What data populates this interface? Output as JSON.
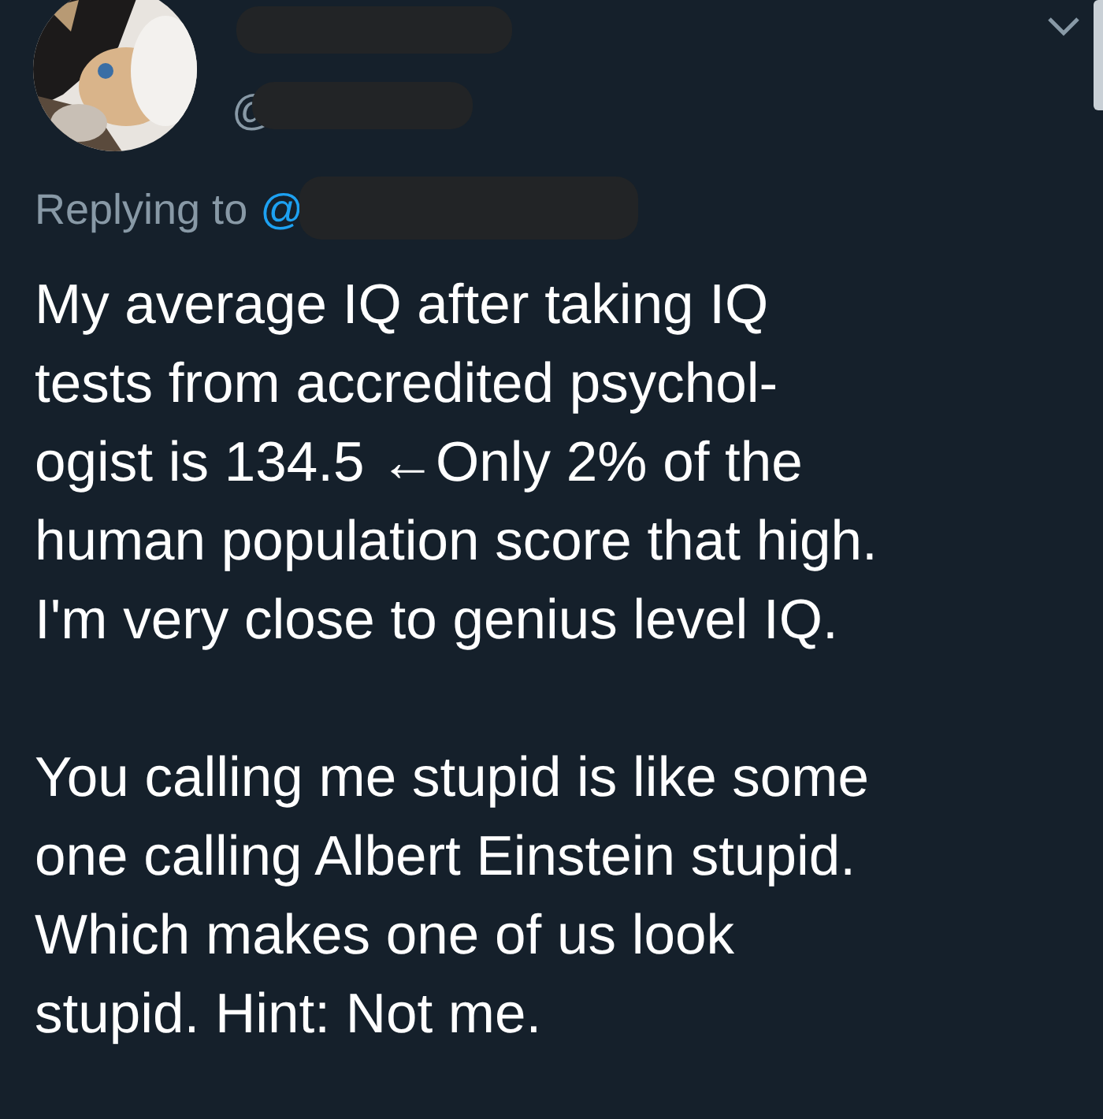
{
  "tweet": {
    "author_handle": "@",
    "replying_label": "Replying to",
    "reply_handle": "@",
    "paragraphs": [
      "My average IQ after taking IQ\ntests from accredited psychol-\nogist is 134.5 ←Only 2% of the\nhuman population score that high.\nI'm very close to genius level IQ.",
      "You calling me stupid is like some\none calling Albert Einstein stupid.\nWhich makes one of us look\nstupid. Hint: Not me."
    ]
  }
}
